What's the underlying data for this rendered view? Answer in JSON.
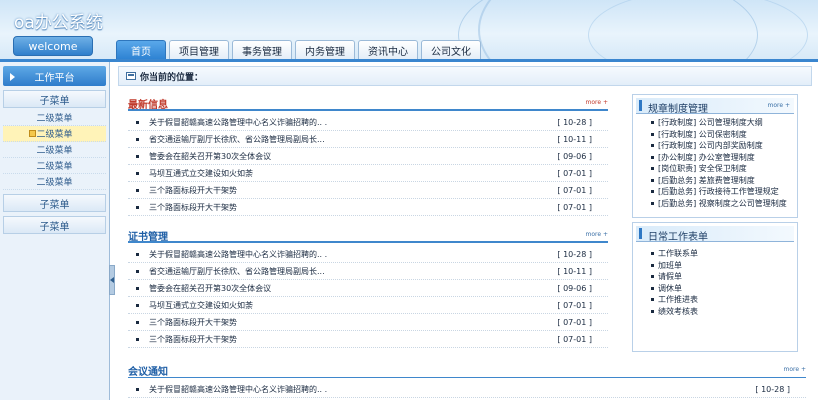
{
  "header": {
    "app_title": "oa办公系统",
    "welcome": "welcome",
    "tabs": [
      "首页",
      "项目管理",
      "事务管理",
      "内务管理",
      "资讯中心",
      "公司文化"
    ]
  },
  "sidebar": {
    "head": "工作平台",
    "groups": [
      {
        "title": "子菜单",
        "items": [
          "二级菜单",
          "二级菜单",
          "二级菜单",
          "二级菜单",
          "二级菜单"
        ],
        "active_index": 1
      },
      {
        "title": "子菜单",
        "items": []
      },
      {
        "title": "子菜单",
        "items": []
      }
    ]
  },
  "location": {
    "label": "你当前的位置："
  },
  "panels": [
    {
      "title": "最新信息",
      "more": "more +",
      "rows": [
        {
          "text": "关于假冒韶赣高速公路管理中心名义诈骗招聘的.. .",
          "date": "[ 10-28 ]"
        },
        {
          "text": "省交通运输厅副厅长徐欣、省公路管理局副局长...",
          "date": "[ 10-11 ]"
        },
        {
          "text": "管委会在韶关召开第30次全体会议",
          "date": "[ 09-06 ]"
        },
        {
          "text": "马坝互通式立交建设如火如荼",
          "date": "[ 07-01 ]"
        },
        {
          "text": "三个路面标段开大干架势",
          "date": "[ 07-01 ]"
        },
        {
          "text": "三个路面标段开大干架势",
          "date": "[ 07-01 ]"
        }
      ]
    },
    {
      "title": "证书管理",
      "more": "more +",
      "rows": [
        {
          "text": "关于假冒韶赣高速公路管理中心名义诈骗招聘的.. .",
          "date": "[ 10-28 ]"
        },
        {
          "text": "省交通运输厅副厅长徐欣、省公路管理局副局长...",
          "date": "[ 10-11 ]"
        },
        {
          "text": "管委会在韶关召开第30次全体会议",
          "date": "[ 09-06 ]"
        },
        {
          "text": "马坝互通式立交建设如火如荼",
          "date": "[ 07-01 ]"
        },
        {
          "text": "三个路面标段开大干架势",
          "date": "[ 07-01 ]"
        },
        {
          "text": "三个路面标段开大干架势",
          "date": "[ 07-01 ]"
        }
      ]
    },
    {
      "title": "会议通知",
      "more": "more +",
      "rows": [
        {
          "text": "关于假冒韶赣高速公路管理中心名义诈骗招聘的.. .",
          "date": "[ 10-28 ]"
        }
      ]
    }
  ],
  "right": {
    "rules": {
      "title": "规章制度管理",
      "more": "more +",
      "items": [
        "[行政制度] 公司管理制度大纲",
        "[行政制度] 公司保密制度",
        "[行政制度] 公司内部奖励制度",
        "[办公制度] 办公室管理制度",
        "[岗位职责] 安全保卫制度",
        "[后勤总务] 差旅费管理制度",
        "[后勤总务] 行政接待工作管理规定",
        "[后勤总务] 视察制度之公司管理制度"
      ]
    },
    "daily": {
      "title": "日常工作表单",
      "items": [
        "工作联系单",
        "加班单",
        "请假单",
        "调休单",
        "工作推进表",
        "绩效考核表"
      ]
    }
  }
}
